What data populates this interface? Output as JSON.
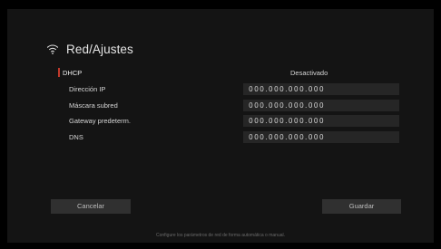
{
  "header": {
    "title": "Red/Ajustes",
    "icon": "wifi-icon"
  },
  "dhcp": {
    "label": "DHCP",
    "value": "Desactivado",
    "marker_color": "#c0392b"
  },
  "fields": [
    {
      "label": "Dirección IP",
      "value": "000.000.000.000"
    },
    {
      "label": "Máscara subred",
      "value": "000.000.000.000"
    },
    {
      "label": "Gateway predeterm.",
      "value": "000.000.000.000"
    },
    {
      "label": "DNS",
      "value": "000.000.000.000"
    }
  ],
  "buttons": {
    "cancel": "Cancelar",
    "save": "Guardar"
  },
  "footer": "Configure los parámetros de red de forma automática o manual."
}
